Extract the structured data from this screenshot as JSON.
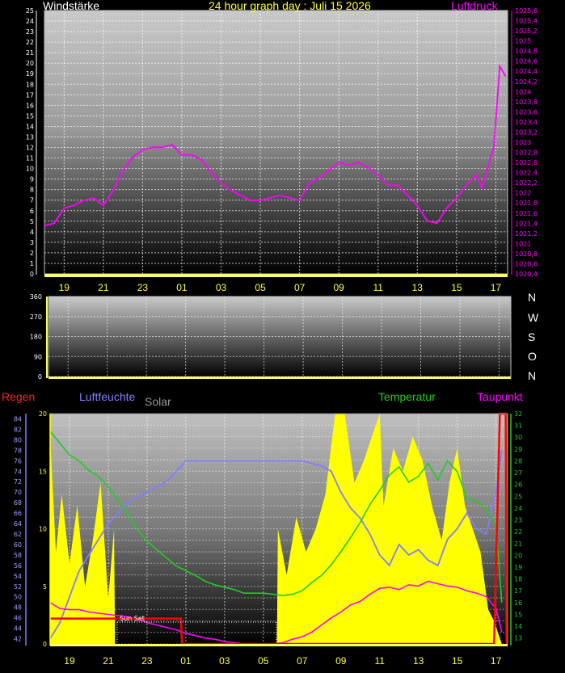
{
  "header": {
    "left_title": "Windstärke",
    "center_title": "24 hour graph day : Juli 15 2026",
    "right_title": "Luftdruck"
  },
  "direction_labels": [
    "N",
    "W",
    "S",
    "O",
    "N"
  ],
  "bottom_legend": {
    "rain": "Regen",
    "humidity": "Luftfeuchte",
    "solar": "Solar",
    "temperature": "Temperatur",
    "dewpoint": "Taupunkt"
  },
  "annotation": "Sun Set",
  "colors": {
    "pressure": "#ff00ff",
    "humidity": "#7f7fff",
    "temperature": "#22cc22",
    "dewpoint": "#ff00ff",
    "rain": "#ff0000",
    "solar": "#ffff00",
    "wind_axis": "#ffffff",
    "pressure_axis": "#ff00ff",
    "x_ticks": "#ffff33"
  },
  "chart_data": [
    {
      "type": "line",
      "panel": "wind-pressure",
      "title": "24 hour graph day : Juli 15 2026",
      "x_ticks": [
        "19",
        "21",
        "23",
        "01",
        "03",
        "05",
        "07",
        "09",
        "11",
        "13",
        "15",
        "17"
      ],
      "x_range_hours": [
        18.0,
        41.6
      ],
      "y_left_label": "Windstärke",
      "y_left_range": [
        0,
        25
      ],
      "y_left_ticks": [
        0,
        1,
        2,
        3,
        4,
        5,
        6,
        7,
        8,
        9,
        10,
        11,
        12,
        13,
        14,
        15,
        16,
        17,
        18,
        19,
        20,
        21,
        22,
        23,
        24,
        25
      ],
      "y_right_label": "Luftdruck",
      "y_right_range": [
        1020.4,
        1025.6
      ],
      "y_right_ticks": [
        "1020,4",
        "1020,6",
        "1020,8",
        "1021",
        "1021,2",
        "1021,4",
        "1021,6",
        "1021,8",
        "1022",
        "1022,2",
        "1022,4",
        "1022,6",
        "1022,8",
        "1023",
        "1023,2",
        "1023,4",
        "1023,6",
        "1023,8",
        "1024",
        "1024,2",
        "1024,4",
        "1024,6",
        "1024,8",
        "1025",
        "1025,2",
        "1025,4",
        "1025,6"
      ],
      "grid": true,
      "series": [
        {
          "name": "Luftdruck",
          "axis": "right",
          "x": [
            18.0,
            18.5,
            19.0,
            19.5,
            20.0,
            20.5,
            21.0,
            21.5,
            22.0,
            22.5,
            23.0,
            23.5,
            24.0,
            24.5,
            25.0,
            25.5,
            26.0,
            26.5,
            27.0,
            27.5,
            28.0,
            28.5,
            29.0,
            29.5,
            30.0,
            30.5,
            31.0,
            31.5,
            32.0,
            32.5,
            33.0,
            33.5,
            34.0,
            34.5,
            35.0,
            35.5,
            36.0,
            36.5,
            37.0,
            37.5,
            38.0,
            38.5,
            39.0,
            39.5,
            40.0,
            40.3,
            40.6,
            40.9,
            41.2,
            41.5
          ],
          "values": [
            1021.35,
            1021.4,
            1021.7,
            1021.75,
            1021.85,
            1021.9,
            1021.75,
            1022.05,
            1022.45,
            1022.7,
            1022.85,
            1022.9,
            1022.9,
            1022.95,
            1022.75,
            1022.75,
            1022.65,
            1022.4,
            1022.2,
            1022.05,
            1021.95,
            1021.85,
            1021.85,
            1021.9,
            1021.95,
            1021.9,
            1021.85,
            1022.2,
            1022.3,
            1022.45,
            1022.6,
            1022.55,
            1022.6,
            1022.5,
            1022.35,
            1022.15,
            1022.15,
            1021.95,
            1021.75,
            1021.45,
            1021.4,
            1021.7,
            1021.9,
            1022.15,
            1022.35,
            1022.1,
            1022.5,
            1022.9,
            1024.5,
            1024.3
          ]
        }
      ]
    },
    {
      "type": "line",
      "panel": "wind-direction",
      "y_range": [
        0,
        360
      ],
      "y_ticks": [
        0,
        90,
        180,
        270,
        360
      ],
      "series": []
    },
    {
      "type": "line",
      "panel": "weather",
      "x_ticks": [
        "19",
        "21",
        "23",
        "01",
        "03",
        "05",
        "07",
        "09",
        "11",
        "13",
        "15",
        "17"
      ],
      "y_left_ticks_rain": [
        0,
        5,
        10,
        15,
        20
      ],
      "y_left_range_rain": [
        0,
        20
      ],
      "y_humidity_ticks": [
        42,
        44,
        46,
        48,
        50,
        52,
        54,
        56,
        58,
        60,
        62,
        64,
        66,
        68,
        70,
        72,
        74,
        76,
        78,
        80,
        82,
        84
      ],
      "y_humidity_range": [
        41,
        85
      ],
      "y_right_ticks": [
        13,
        14,
        15,
        16,
        17,
        18,
        19,
        20,
        21,
        22,
        23,
        24,
        25,
        26,
        27,
        28,
        29,
        30,
        31,
        32
      ],
      "y_right_range": [
        12.5,
        32
      ],
      "series": [
        {
          "name": "Solar",
          "axis": "rain",
          "x": [
            18.0,
            18.3,
            18.6,
            19.0,
            19.4,
            19.8,
            20.2,
            20.6,
            21.0,
            21.3,
            21.35,
            29.7,
            29.75,
            30.2,
            30.7,
            31.2,
            31.7,
            32.2,
            32.7,
            33.2,
            33.7,
            34.2,
            34.6,
            35.0,
            35.2,
            35.7,
            36.2,
            36.7,
            37.2,
            37.7,
            38.2,
            38.6,
            39.0,
            39.4,
            39.8,
            40.2,
            40.6,
            40.9,
            41.1,
            41.3
          ],
          "values": [
            18,
            8,
            13,
            7,
            12,
            5,
            9,
            14,
            4,
            10,
            0,
            0,
            10,
            6,
            11,
            8,
            10,
            13,
            20,
            20,
            14,
            16,
            18,
            20,
            12,
            17,
            15,
            18,
            16,
            12,
            9,
            14,
            17,
            12,
            10,
            8,
            3,
            2,
            1,
            0
          ]
        },
        {
          "name": "Luftfeuchte",
          "axis": "humidity",
          "x": [
            18.0,
            18.5,
            19.0,
            19.5,
            20.0,
            20.5,
            21.0,
            21.5,
            22.0,
            22.5,
            23.0,
            23.5,
            24.0,
            24.5,
            25.0,
            26.0,
            27.0,
            28.0,
            29.0,
            30.0,
            31.0,
            32.0,
            32.5,
            33.0,
            33.5,
            34.0,
            34.5,
            35.0,
            35.5,
            36.0,
            36.5,
            37.0,
            37.5,
            38.0,
            38.5,
            39.0,
            39.5,
            40.0,
            40.5,
            41.0,
            41.3
          ],
          "values": [
            42,
            45,
            50,
            55,
            58,
            61,
            64,
            66,
            68,
            69,
            70,
            71,
            72,
            74,
            76,
            76,
            76,
            76,
            76,
            76,
            76,
            75,
            74,
            70,
            67,
            65,
            62,
            58,
            56,
            60,
            58,
            59,
            57,
            56,
            61,
            63,
            66,
            63,
            62,
            70,
            78
          ]
        },
        {
          "name": "Temperatur",
          "axis": "right",
          "x": [
            18.0,
            18.5,
            19.0,
            19.5,
            20.0,
            20.5,
            21.0,
            21.5,
            22.0,
            22.5,
            23.0,
            23.5,
            24.0,
            24.5,
            25.0,
            25.5,
            26.0,
            26.5,
            27.0,
            27.5,
            28.0,
            28.5,
            29.0,
            29.5,
            30.0,
            30.5,
            31.0,
            31.5,
            32.0,
            32.5,
            33.0,
            33.5,
            34.0,
            34.5,
            35.0,
            35.5,
            36.0,
            36.5,
            37.0,
            37.5,
            38.0,
            38.5,
            39.0,
            39.5,
            40.0,
            40.5,
            41.0,
            41.3
          ],
          "values": [
            30.5,
            29.5,
            28.5,
            28,
            27.2,
            26.7,
            25.8,
            24.7,
            23.5,
            22.2,
            21.2,
            20.5,
            19.8,
            19.1,
            18.7,
            18.3,
            17.8,
            17.5,
            17.3,
            17.1,
            16.8,
            16.8,
            16.8,
            16.7,
            16.6,
            16.7,
            17,
            17.7,
            18.3,
            19.2,
            20.3,
            21.5,
            22.8,
            24.3,
            25.5,
            26.8,
            27.5,
            26.2,
            26.7,
            27.8,
            26.4,
            28,
            27.1,
            24.8,
            24.6,
            23.9,
            22.6,
            16
          ]
        },
        {
          "name": "Taupunkt",
          "axis": "right",
          "x": [
            18.0,
            18.5,
            19.0,
            19.5,
            20.0,
            20.5,
            21.0,
            21.5,
            22.0,
            22.5,
            23.0,
            23.5,
            24.0,
            24.5,
            25.0,
            25.5,
            26.0,
            26.5,
            27.0,
            27.5,
            28.0,
            28.5,
            29.0,
            29.5,
            30.0,
            30.5,
            31.0,
            31.5,
            32.0,
            32.5,
            33.0,
            33.5,
            34.0,
            34.5,
            35.0,
            35.5,
            36.0,
            36.5,
            37.0,
            37.5,
            38.0,
            38.5,
            39.0,
            39.5,
            40.0,
            40.5,
            41.0,
            41.3
          ],
          "values": [
            16,
            15.5,
            15.4,
            15.4,
            15.2,
            15.1,
            15,
            14.9,
            14.8,
            14.6,
            14.3,
            14.1,
            13.9,
            13.7,
            13.4,
            13.2,
            13,
            12.9,
            12.7,
            12.6,
            12.5,
            12.5,
            12.5,
            12.5,
            12.6,
            12.9,
            13.1,
            13.5,
            14.1,
            14.7,
            15.2,
            15.8,
            16.1,
            16.7,
            17.2,
            17.3,
            17.1,
            17.5,
            17.4,
            17.8,
            17.6,
            17.4,
            17.3,
            17,
            16.8,
            16.5,
            15.5,
            13.5
          ]
        },
        {
          "name": "Regen",
          "axis": "rain",
          "x": [
            18.0,
            24.75,
            24.8,
            40.9,
            41.2,
            41.25,
            41.5,
            41.55
          ],
          "values": [
            2.2,
            2.2,
            0,
            0,
            20,
            20,
            20,
            0
          ]
        }
      ]
    }
  ]
}
